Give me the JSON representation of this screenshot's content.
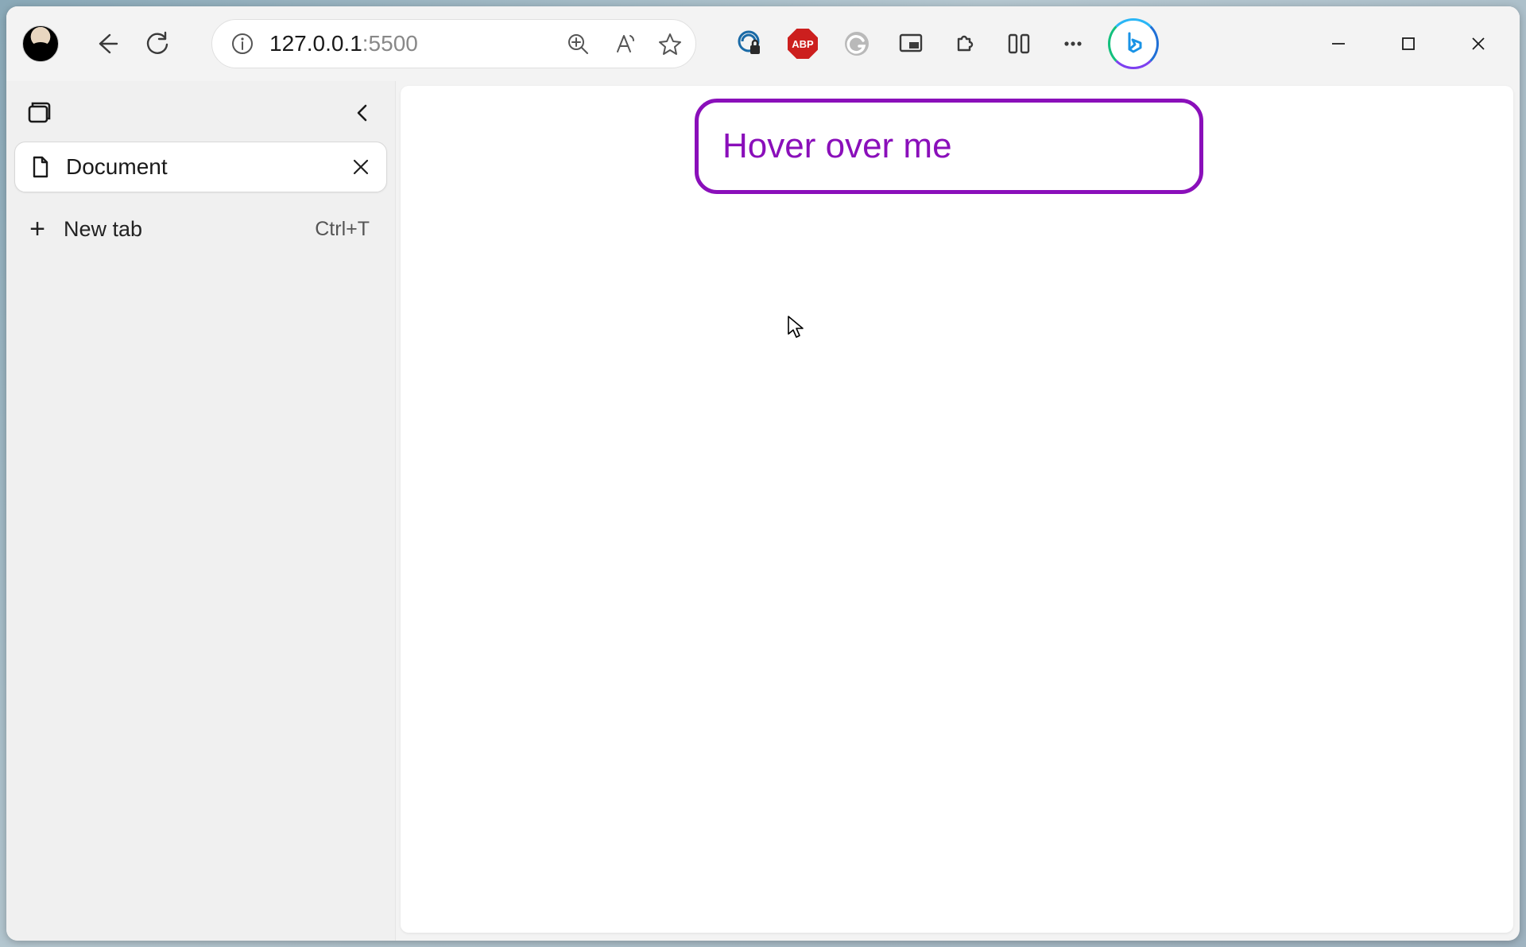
{
  "address_bar": {
    "host": "127.0.0.1",
    "port": ":5500"
  },
  "extensions": {
    "abp_label": "ABP"
  },
  "sidebar": {
    "tab_title": "Document",
    "new_tab_label": "New tab",
    "new_tab_shortcut": "Ctrl+T"
  },
  "page": {
    "hover_text": "Hover over me"
  }
}
